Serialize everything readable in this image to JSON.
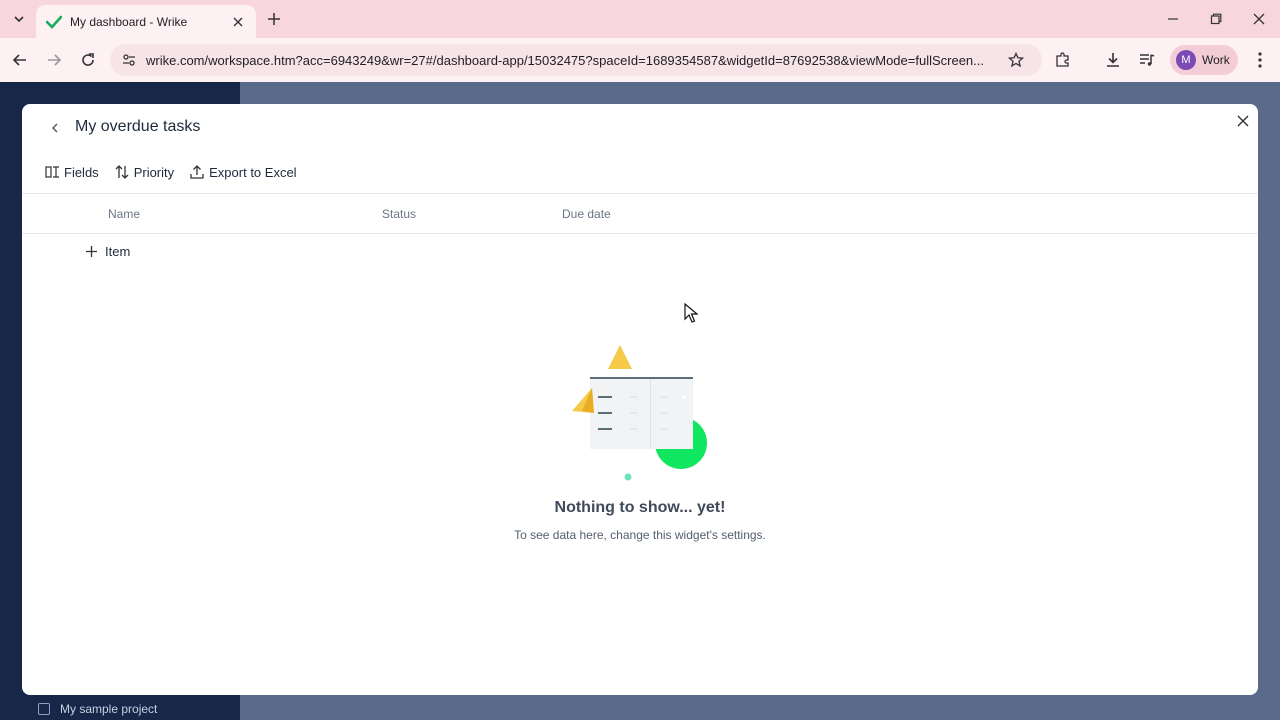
{
  "browser": {
    "tab_title": "My dashboard - Wrike",
    "url": "wrike.com/workspace.htm?acc=6943249&wr=27#/dashboard-app/15032475?spaceId=1689354587&widgetId=87692538&viewMode=fullScreen...",
    "profile_initial": "M",
    "profile_label": "Work"
  },
  "sidebar": {
    "project_label": "My sample project"
  },
  "modal": {
    "title": "My overdue tasks",
    "actions": {
      "fields": "Fields",
      "priority": "Priority",
      "export": "Export to Excel"
    },
    "columns": {
      "name": "Name",
      "status": "Status",
      "due_date": "Due date"
    },
    "add_item_label": "Item",
    "empty_title": "Nothing to show... yet!",
    "empty_subtitle": "To see data here, change this widget's settings."
  },
  "colors": {
    "brand_green": "#10d65a",
    "accent_yellow": "#f7c948",
    "sidebar_navy": "#16274a"
  }
}
